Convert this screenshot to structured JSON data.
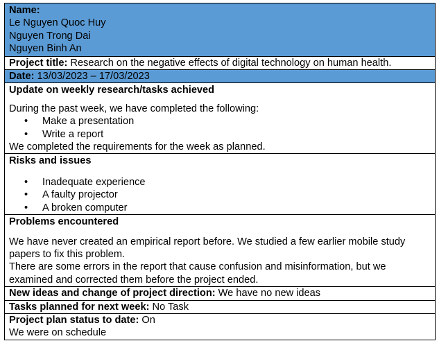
{
  "name": {
    "label": "Name:",
    "members": [
      "Le Nguyen Quoc Huy",
      "Nguyen Trong Dai",
      "Nguyen Binh An"
    ]
  },
  "project": {
    "label": "Project title:",
    "value": " Research on the negative effects of digital technology on human health."
  },
  "date": {
    "label": "Date:",
    "value": " 13/03/2023 – 17/03/2023"
  },
  "update": {
    "heading": "Update on weekly research/tasks achieved",
    "intro": "During the past week, we have completed the following:",
    "items": [
      "Make a presentation",
      "Write a report"
    ],
    "closing": "We completed the requirements for the week as planned."
  },
  "risks": {
    "heading": "Risks and issues",
    "items": [
      "Inadequate experience",
      "A faulty projector",
      "A broken computer"
    ]
  },
  "problems": {
    "heading": "Problems encountered",
    "paragraph1": "We have never created an empirical report before. We studied a few earlier mobile study papers to fix this problem.",
    "paragraph2": "There are some errors in the report that cause confusion and misinformation, but we examined and corrected them before the project ended."
  },
  "ideas": {
    "label": "New ideas and change of project direction:",
    "value": " We have no new ideas"
  },
  "tasks": {
    "label": "Tasks planned for next week:",
    "value": " No Task"
  },
  "status": {
    "label": "Project plan status to date:",
    "value": " On",
    "note": "We were on schedule"
  },
  "colors": {
    "header_blue": "#5b9bd5",
    "border": "#000000"
  }
}
